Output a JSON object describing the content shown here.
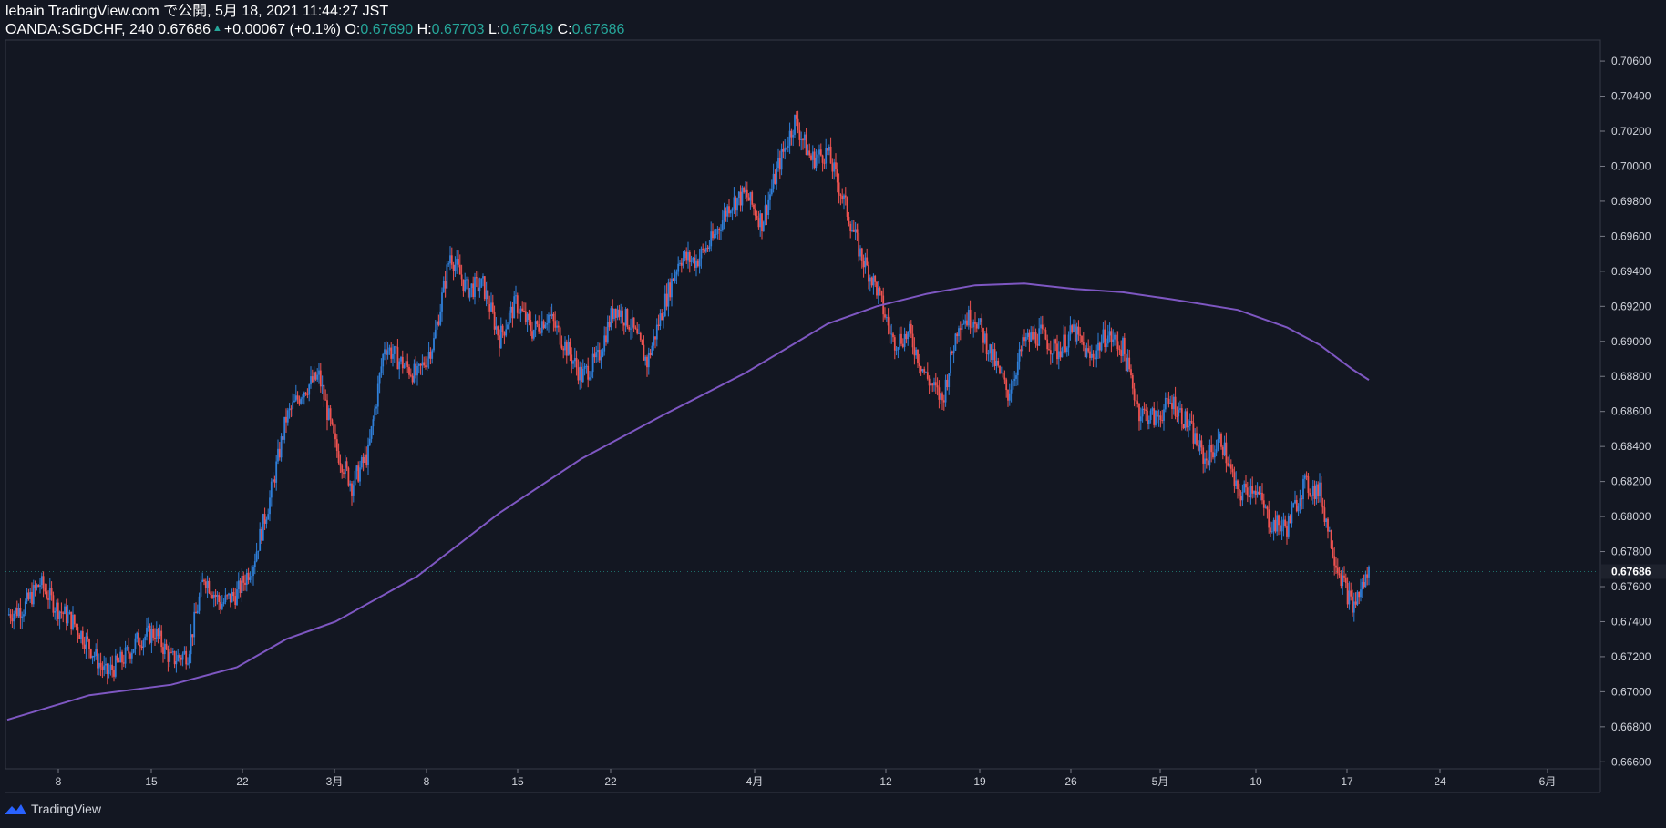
{
  "header": {
    "line1": "lebain TradingView.com で公開, 5月 18, 2021 11:44:27 JST",
    "symbol": "OANDA:SGDCHF, 240",
    "last": "0.67686",
    "change": "+0.00067 (+0.1%)",
    "o_label": "O:",
    "o": "0.67690",
    "h_label": "H:",
    "h": "0.67703",
    "l_label": "L:",
    "l": "0.67649",
    "c_label": "C:",
    "c": "0.67686"
  },
  "footer": {
    "brand": "TradingView",
    "icon": "tradingview-logo-icon"
  },
  "colors": {
    "background": "#131722",
    "up": "#2f7fd9",
    "down": "#ef5350",
    "ma": "#7e57c2",
    "axis_text": "#d1d4dc",
    "grid_border": "#363a45"
  },
  "chart_data": {
    "type": "candlestick",
    "symbol": "OANDA:SGDCHF",
    "interval": "240",
    "ylim": [
      0.6656,
      0.7072
    ],
    "y_ticks": [
      "0.70600",
      "0.70400",
      "0.70200",
      "0.70000",
      "0.69800",
      "0.69600",
      "0.69400",
      "0.69200",
      "0.69000",
      "0.68800",
      "0.68600",
      "0.68400",
      "0.68200",
      "0.68000",
      "0.67800",
      "0.67600",
      "0.67400",
      "0.67200",
      "0.67000",
      "0.66800",
      "0.66600"
    ],
    "last_price_label": "0.67686",
    "x_ticks": [
      "8",
      "15",
      "22",
      "3月",
      "8",
      "15",
      "22",
      "4月",
      "12",
      "19",
      "26",
      "5月",
      "10",
      "17",
      "24",
      "6月"
    ],
    "price_path": [
      [
        0,
        0.6744
      ],
      [
        2,
        0.6748
      ],
      [
        4,
        0.6762
      ],
      [
        6,
        0.6748
      ],
      [
        8,
        0.674
      ],
      [
        10,
        0.6726
      ],
      [
        12,
        0.671
      ],
      [
        14,
        0.6718
      ],
      [
        16,
        0.673
      ],
      [
        18,
        0.6734
      ],
      [
        20,
        0.6718
      ],
      [
        22,
        0.6722
      ],
      [
        24,
        0.6766
      ],
      [
        26,
        0.675
      ],
      [
        28,
        0.6756
      ],
      [
        30,
        0.6774
      ],
      [
        32,
        0.681
      ],
      [
        34,
        0.6856
      ],
      [
        36,
        0.6872
      ],
      [
        38,
        0.688
      ],
      [
        40,
        0.684
      ],
      [
        42,
        0.6818
      ],
      [
        44,
        0.6836
      ],
      [
        46,
        0.6898
      ],
      [
        48,
        0.6888
      ],
      [
        50,
        0.688
      ],
      [
        52,
        0.69
      ],
      [
        54,
        0.695
      ],
      [
        56,
        0.693
      ],
      [
        58,
        0.6932
      ],
      [
        60,
        0.6902
      ],
      [
        62,
        0.6922
      ],
      [
        64,
        0.6906
      ],
      [
        66,
        0.6915
      ],
      [
        68,
        0.6898
      ],
      [
        70,
        0.688
      ],
      [
        72,
        0.689
      ],
      [
        74,
        0.692
      ],
      [
        76,
        0.691
      ],
      [
        78,
        0.6888
      ],
      [
        80,
        0.692
      ],
      [
        82,
        0.6948
      ],
      [
        84,
        0.6946
      ],
      [
        86,
        0.6958
      ],
      [
        88,
        0.6978
      ],
      [
        90,
        0.6984
      ],
      [
        92,
        0.6968
      ],
      [
        94,
        0.7
      ],
      [
        96,
        0.7026
      ],
      [
        98,
        0.7004
      ],
      [
        100,
        0.7008
      ],
      [
        102,
        0.698
      ],
      [
        104,
        0.695
      ],
      [
        106,
        0.693
      ],
      [
        108,
        0.69
      ],
      [
        110,
        0.6904
      ],
      [
        112,
        0.688
      ],
      [
        114,
        0.6866
      ],
      [
        116,
        0.6912
      ],
      [
        118,
        0.6914
      ],
      [
        120,
        0.6892
      ],
      [
        122,
        0.687
      ],
      [
        124,
        0.69
      ],
      [
        126,
        0.6904
      ],
      [
        128,
        0.6894
      ],
      [
        130,
        0.6906
      ],
      [
        132,
        0.689
      ],
      [
        134,
        0.6904
      ],
      [
        136,
        0.6896
      ],
      [
        138,
        0.686
      ],
      [
        140,
        0.6856
      ],
      [
        142,
        0.6866
      ],
      [
        144,
        0.6852
      ],
      [
        146,
        0.6832
      ],
      [
        148,
        0.6844
      ],
      [
        150,
        0.6812
      ],
      [
        152,
        0.6818
      ],
      [
        154,
        0.6796
      ],
      [
        156,
        0.6794
      ],
      [
        158,
        0.6818
      ],
      [
        160,
        0.6814
      ],
      [
        162,
        0.6774
      ],
      [
        164,
        0.6748
      ],
      [
        165,
        0.6758
      ],
      [
        166,
        0.67686
      ]
    ],
    "moving_average": [
      [
        0,
        0.6684
      ],
      [
        10,
        0.6698
      ],
      [
        20,
        0.6704
      ],
      [
        28,
        0.6714
      ],
      [
        34,
        0.673
      ],
      [
        40,
        0.674
      ],
      [
        50,
        0.6766
      ],
      [
        60,
        0.6802
      ],
      [
        70,
        0.6833
      ],
      [
        80,
        0.6858
      ],
      [
        90,
        0.6882
      ],
      [
        100,
        0.691
      ],
      [
        106,
        0.692
      ],
      [
        112,
        0.6927
      ],
      [
        118,
        0.6932
      ],
      [
        124,
        0.6933
      ],
      [
        130,
        0.693
      ],
      [
        136,
        0.6928
      ],
      [
        142,
        0.6924
      ],
      [
        150,
        0.6918
      ],
      [
        156,
        0.6908
      ],
      [
        160,
        0.6898
      ],
      [
        164,
        0.6884
      ],
      [
        166,
        0.6878
      ]
    ]
  }
}
